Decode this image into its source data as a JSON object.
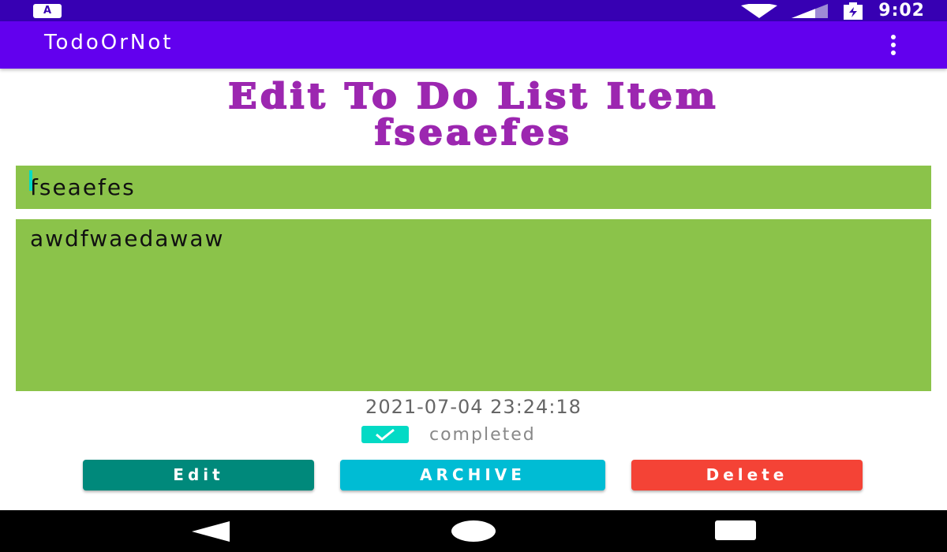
{
  "status_bar": {
    "time": "9:02",
    "left_icon": "A"
  },
  "app_bar": {
    "title": "TodoOrNot",
    "overflow_icon": "overflow-menu-icon"
  },
  "heading": {
    "line1": "Edit To Do List Item",
    "line2": "fseaefes"
  },
  "form": {
    "title_value": "fseaefes",
    "description_value": "awdfwaedawaw"
  },
  "timestamp": "2021-07-04 23:24:18",
  "completed": {
    "label": "completed",
    "checked": true
  },
  "buttons": {
    "edit": "Edit",
    "archive": "ARCHIVE",
    "delete": "Delete"
  },
  "colors": {
    "status_bar": "#3700b3",
    "app_bar": "#6200ee",
    "heading": "#9c27b0",
    "field_bg": "#8bc34a",
    "accent": "#03dac5",
    "edit_button": "#00897b",
    "archive_button": "#00bcd4",
    "delete_button": "#f44336"
  }
}
